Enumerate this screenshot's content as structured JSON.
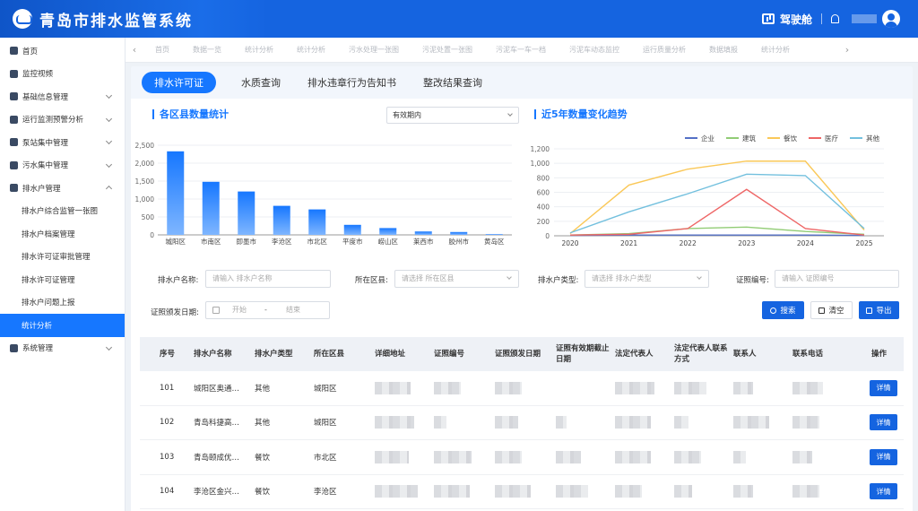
{
  "app": {
    "title": "青岛市排水监管系统",
    "cockpit_label": "驾驶舱"
  },
  "sidebar": {
    "items": [
      {
        "label": "首页",
        "icon": "home-icon",
        "has_children": false
      },
      {
        "label": "监控视频",
        "icon": "camera-icon",
        "has_children": false
      },
      {
        "label": "基础信息管理",
        "icon": "document-icon",
        "has_children": true
      },
      {
        "label": "运行监测预警分析",
        "icon": "alert-icon",
        "has_children": true
      },
      {
        "label": "泵站集中管理",
        "icon": "pump-icon",
        "has_children": true
      },
      {
        "label": "污水集中管理",
        "icon": "water-icon",
        "has_children": true
      },
      {
        "label": "排水户管理",
        "icon": "building-icon",
        "has_children": true,
        "expanded": true
      }
    ],
    "subitems": [
      {
        "label": "排水户综合监管一张图"
      },
      {
        "label": "排水户档案管理"
      },
      {
        "label": "排水许可证审批管理"
      },
      {
        "label": "排水许可证管理"
      },
      {
        "label": "排水户问题上报"
      },
      {
        "label": "统计分析",
        "active": true
      }
    ],
    "bottom_item": {
      "label": "系统管理",
      "icon": "settings-icon",
      "has_children": true
    }
  },
  "tabbar": {
    "tabs": [
      "首页",
      "数据一览",
      "统计分析",
      "统计分析",
      "污水处理一张图",
      "污泥处置一张图",
      "污泥车一车一档",
      "污泥车动态监控",
      "运行质量分析",
      "数据填报",
      "统计分析"
    ]
  },
  "main_tabs": [
    {
      "label": "排水许可证",
      "active": true
    },
    {
      "label": "水质查询"
    },
    {
      "label": "排水违章行为告知书"
    },
    {
      "label": "整改结果查询"
    }
  ],
  "left_panel": {
    "title": "各区县数量统计",
    "select_value": "有效期内"
  },
  "right_panel": {
    "title": "近5年数量变化趋势"
  },
  "chart_data": [
    {
      "type": "bar",
      "categories": [
        "城阳区",
        "市南区",
        "即墨市",
        "李沧区",
        "市北区",
        "平度市",
        "崂山区",
        "莱西市",
        "胶州市",
        "黄岛区"
      ],
      "values": [
        2330,
        1480,
        1210,
        810,
        710,
        280,
        190,
        95,
        80,
        20
      ],
      "ylim": [
        0,
        2500
      ],
      "yticks": [
        "0",
        "500",
        "1,000",
        "1,500",
        "2,000",
        "2,500"
      ],
      "grid": true
    },
    {
      "type": "line",
      "x": [
        "2020",
        "2021",
        "2022",
        "2023",
        "2024",
        "2025"
      ],
      "series": [
        {
          "name": "企业",
          "color": "#5470c6",
          "values": [
            5,
            10,
            10,
            10,
            10,
            5
          ]
        },
        {
          "name": "建筑",
          "color": "#91cc75",
          "values": [
            10,
            30,
            100,
            120,
            60,
            20
          ]
        },
        {
          "name": "餐饮",
          "color": "#fac858",
          "values": [
            30,
            700,
            920,
            1030,
            1030,
            80
          ]
        },
        {
          "name": "医疗",
          "color": "#ee6666",
          "values": [
            10,
            20,
            100,
            640,
            100,
            10
          ]
        },
        {
          "name": "其他",
          "color": "#73c0de",
          "values": [
            40,
            330,
            580,
            850,
            830,
            100
          ]
        }
      ],
      "ylim": [
        0,
        1200
      ],
      "yticks": [
        "0",
        "200",
        "400",
        "600",
        "800",
        "1,000",
        "1,200"
      ],
      "legend_position": "top-right",
      "grid": true
    }
  ],
  "filters": {
    "name_label": "排水户名称:",
    "name_placeholder": "请输入 排水户名称",
    "district_label": "所在区县:",
    "district_placeholder": "请选择 所在区县",
    "type_label": "排水户类型:",
    "type_placeholder": "请选择 排水户类型",
    "cert_label": "证照编号:",
    "cert_placeholder": "请输入 证照编号",
    "date_label": "证照颁发日期:",
    "date_start": "开始",
    "date_sep": "-",
    "date_end": "结束"
  },
  "buttons": {
    "search": "搜索",
    "clear": "清空",
    "export": "导出"
  },
  "table": {
    "columns": [
      "序号",
      "排水户名称",
      "排水户类型",
      "所在区县",
      "详细地址",
      "证照编号",
      "证照颁发日期",
      "证照有效期截止日期",
      "法定代表人",
      "法定代表人联系方式",
      "联系人",
      "联系电话",
      "操作"
    ],
    "rows": [
      {
        "no": "101",
        "name": "城阳区奥通…",
        "type": "其他",
        "district": "城阳区"
      },
      {
        "no": "102",
        "name": "青岛科捷高…",
        "type": "其他",
        "district": "城阳区"
      },
      {
        "no": "103",
        "name": "青岛颐成优…",
        "type": "餐饮",
        "district": "市北区"
      },
      {
        "no": "104",
        "name": "李沧区金兴…",
        "type": "餐饮",
        "district": "李沧区"
      }
    ],
    "action_label": "详情"
  }
}
